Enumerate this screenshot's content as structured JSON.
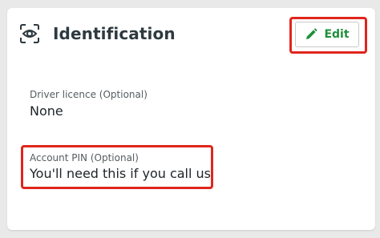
{
  "section": {
    "icon": "eye-scan-icon",
    "title": "Identification"
  },
  "edit_button": {
    "icon": "pencil-icon",
    "label": "Edit"
  },
  "fields": [
    {
      "label": "Driver licence (Optional)",
      "value": "None"
    },
    {
      "label": "Account PIN (Optional)",
      "value": "You'll need this if you call us"
    }
  ],
  "colors": {
    "accent_green": "#1f8f3a",
    "highlight_red": "#e0261c",
    "title_text": "#2e3a40"
  }
}
